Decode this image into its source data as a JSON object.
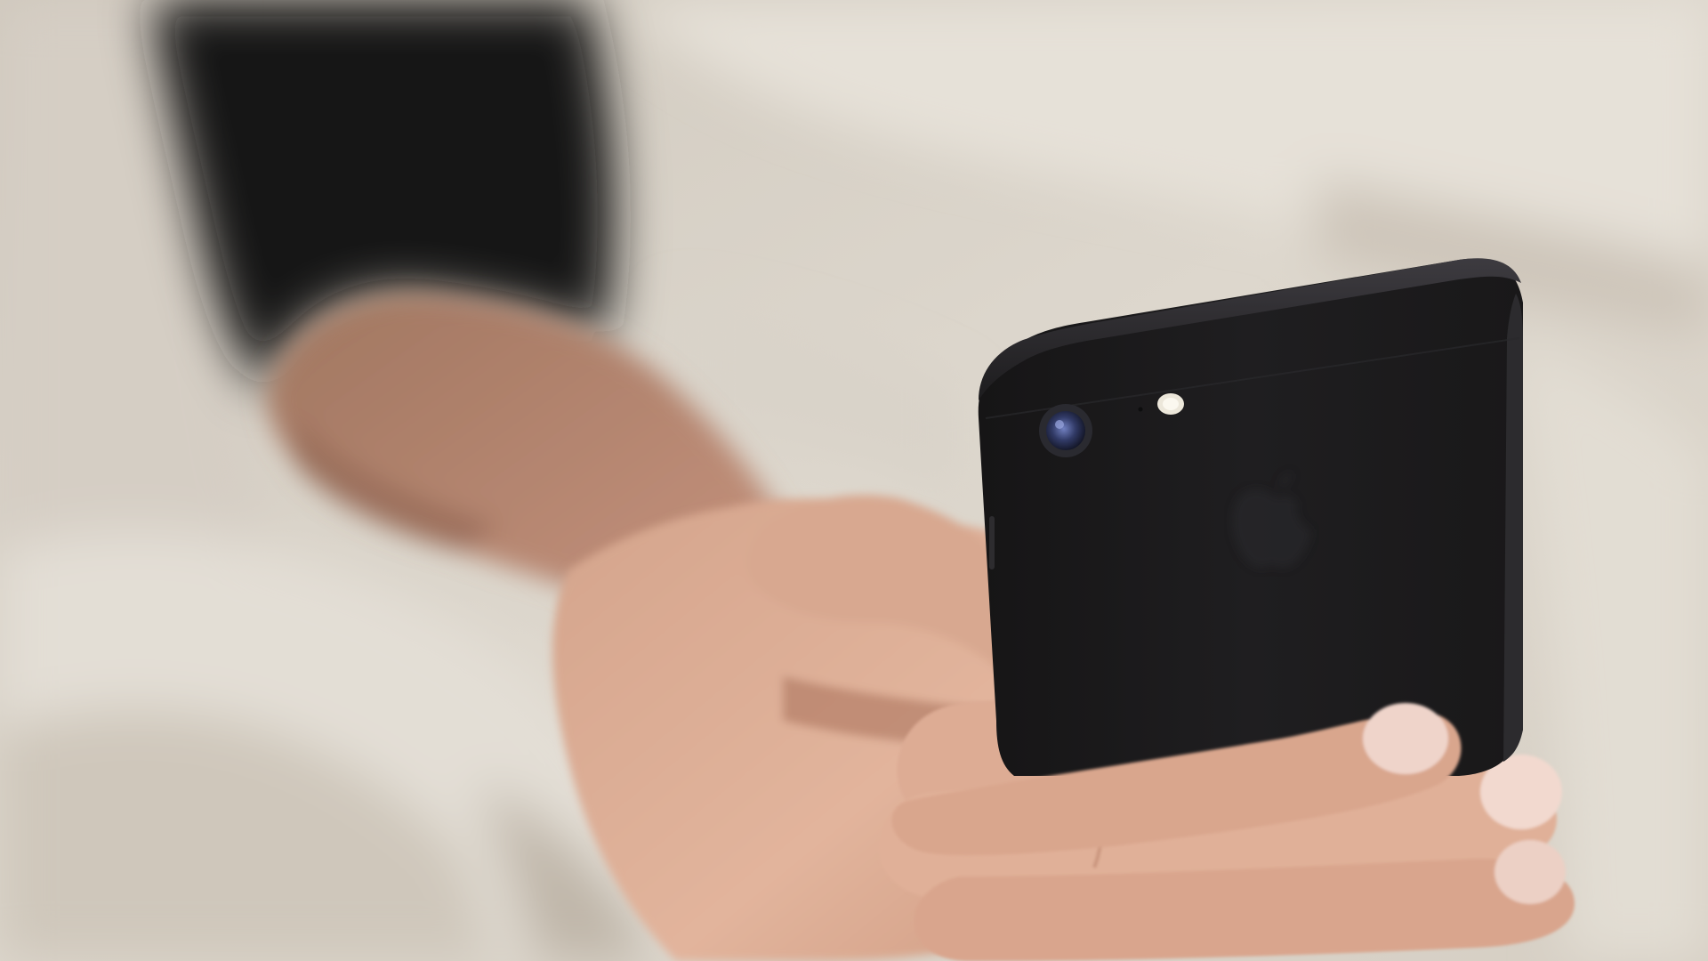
{
  "scene": {
    "palette": {
      "sheet_light": "#e4dfd6",
      "sheet_mid": "#d2cbbf",
      "sheet_shadow": "#b9b0a3",
      "sleeve": "#141212",
      "skin_light": "#e2b7a0",
      "skin_mid": "#cf9a80",
      "skin_shadow": "#a9725c",
      "nail": "#efd5cc",
      "phone_body": "#1c1b1c",
      "phone_edge": "#2b2a2c",
      "phone_highlight": "#46444a",
      "lens_ring": "#3a3b44",
      "lens_glass": "#3f4a7a",
      "flash": "#e9e4d7"
    }
  }
}
